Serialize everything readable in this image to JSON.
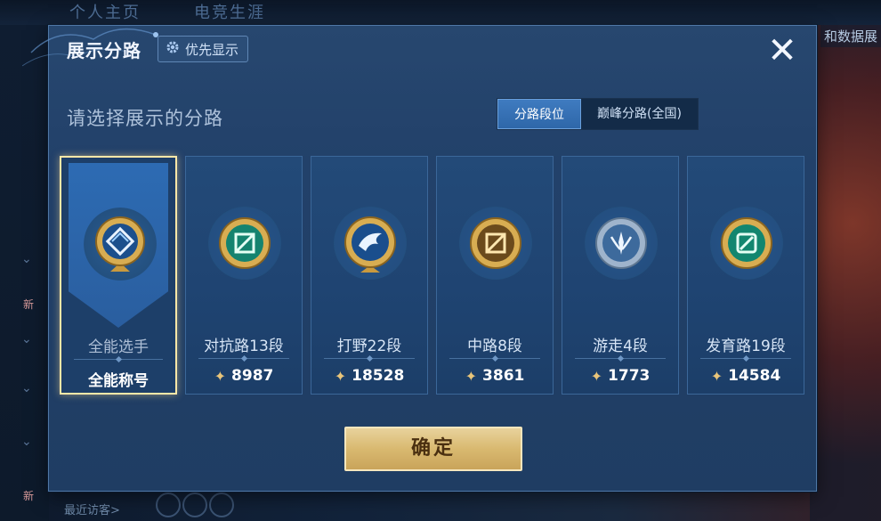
{
  "background": {
    "tabs": [
      "个人主页",
      "电竞生涯"
    ],
    "right_hint": "和数据展",
    "new_badge": "新",
    "recent_visitors": "最近访客>"
  },
  "modal": {
    "title": "展示分路",
    "priority_button": "优先显示",
    "close_symbol": "✕",
    "prompt": "请选择展示的分路",
    "tabs": [
      {
        "label": "分路段位",
        "active": true
      },
      {
        "label": "巅峰分路(全国)",
        "active": false
      }
    ],
    "cards": [
      {
        "title": "全能选手",
        "footer": "全能称号",
        "selected": true,
        "icon": "all-round-emblem-icon"
      },
      {
        "title": "对抗路13段",
        "score": "8987",
        "selected": false,
        "icon": "clash-lane-emblem-icon"
      },
      {
        "title": "打野22段",
        "score": "18528",
        "selected": false,
        "icon": "jungle-emblem-icon"
      },
      {
        "title": "中路8段",
        "score": "3861",
        "selected": false,
        "icon": "mid-lane-emblem-icon"
      },
      {
        "title": "游走4段",
        "score": "1773",
        "selected": false,
        "icon": "roam-emblem-icon"
      },
      {
        "title": "发育路19段",
        "score": "14584",
        "selected": false,
        "icon": "farm-lane-emblem-icon"
      }
    ],
    "confirm_label": "确定"
  },
  "colors": {
    "accent_gold": "#d9b970",
    "panel_blue": "#22416a",
    "tab_active": "#3f7bc0"
  }
}
